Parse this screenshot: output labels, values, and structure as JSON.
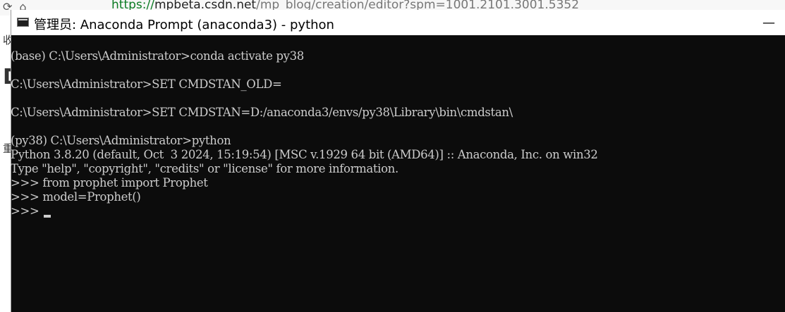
{
  "background_browser": {
    "url_scheme": "https://",
    "url_host": "mpbeta.csdn.net",
    "url_path": "/mp_blog/creation/editor?spm=1001.2101.3001.5352",
    "side_chars": [
      "收",
      "D",
      "重"
    ]
  },
  "console": {
    "title": "管理员: Anaconda Prompt (anaconda3) - python",
    "minimize_glyph": "—",
    "lines": [
      "(base) C:\\Users\\Administrator>conda activate py38",
      "",
      "C:\\Users\\Administrator>SET CMDSTAN_OLD=",
      "",
      "C:\\Users\\Administrator>SET CMDSTAN=D:/anaconda3/envs/py38\\Library\\bin\\cmdstan\\",
      "",
      "(py38) C:\\Users\\Administrator>python",
      "Python 3.8.20 (default, Oct  3 2024, 15:19:54) [MSC v.1929 64 bit (AMD64)] :: Anaconda, Inc. on win32",
      "Type \"help\", \"copyright\", \"credits\" or \"license\" for more information.",
      ">>> from prophet import Prophet",
      ">>> model=Prophet()"
    ],
    "current_prompt": ">>> "
  },
  "icons": {
    "window_icon": "console-icon",
    "minimize": "minimize-icon"
  }
}
